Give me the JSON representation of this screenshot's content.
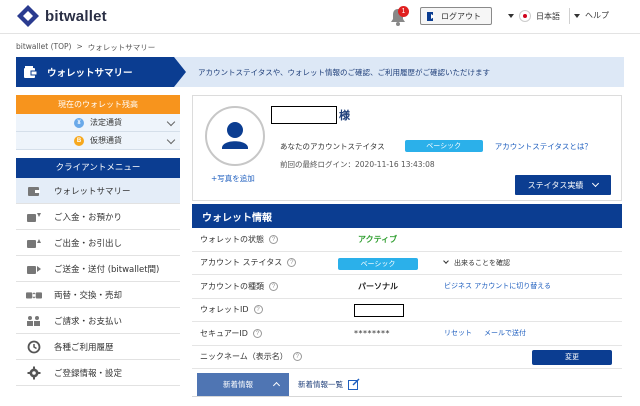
{
  "header": {
    "logo_text": "bitwallet",
    "notification_count": "1",
    "logout_label": "ログアウト",
    "language_label": "日本語",
    "help_label": "ヘルプ"
  },
  "breadcrumb": {
    "home": "bitwallet (TOP)",
    "separator": ">",
    "current": "ウォレットサマリー"
  },
  "page": {
    "title": "ウォレットサマリー",
    "description": "アカウントステイタスや、ウォレット情報のご確認、ご利用履歴がご確認いただけます"
  },
  "sidebar": {
    "balance_header": "現在のウォレット残高",
    "balances": [
      {
        "label": "法定通貨",
        "icon": "fiat-coin-icon"
      },
      {
        "label": "仮想通貨",
        "icon": "bitcoin-icon"
      }
    ],
    "menu_header": "クライアントメニュー",
    "menu": [
      {
        "label": "ウォレットサマリー",
        "icon": "wallet-icon",
        "active": true
      },
      {
        "label": "ご入金・お預かり",
        "icon": "deposit-icon"
      },
      {
        "label": "ご出金・お引出し",
        "icon": "withdraw-icon"
      },
      {
        "label": "ご送金・送付 (bitwallet間)",
        "icon": "transfer-icon"
      },
      {
        "label": "両替・交換・売却",
        "icon": "exchange-icon"
      },
      {
        "label": "ご請求・お支払い",
        "icon": "invoice-icon"
      },
      {
        "label": "各種ご利用履歴",
        "icon": "history-icon"
      },
      {
        "label": "ご登録情報・設定",
        "icon": "gear-icon"
      }
    ]
  },
  "profile": {
    "add_photo": "+写真を追加",
    "name_suffix": "様",
    "status_label": "あなたのアカウントステイタス",
    "status_value": "ベーシック",
    "status_link": "アカウントステイタスとは？",
    "last_login": "前回の最終ログイン：2020-11-16 13:43:08",
    "status_button": "ステイタス実績"
  },
  "wallet": {
    "heading": "ウォレット情報",
    "rows": {
      "state": {
        "label": "ウォレットの状態",
        "value": "アクティブ"
      },
      "account_status": {
        "label": "アカウント ステイタス",
        "value": "ベーシック",
        "link": "出来ることを確認"
      },
      "account_type": {
        "label": "アカウントの種類",
        "value": "パーソナル",
        "link": "ビジネス アカウントに切り替える"
      },
      "wallet_id": {
        "label": "ウォレットID"
      },
      "secure_id": {
        "label": "セキュアーID",
        "value": "********",
        "reset": "リセット",
        "email": "メールで送付"
      },
      "nickname": {
        "label": "ニックネーム（表示名）",
        "button": "変更"
      }
    }
  },
  "news": {
    "tab_label": "新着情報",
    "list_label": "新着情報一覧"
  },
  "colors": {
    "primary_navy": "#0b3d91",
    "accent_orange": "#f7941d",
    "badge_blue": "#2bb0ea",
    "active_green": "#2f9e2f"
  }
}
